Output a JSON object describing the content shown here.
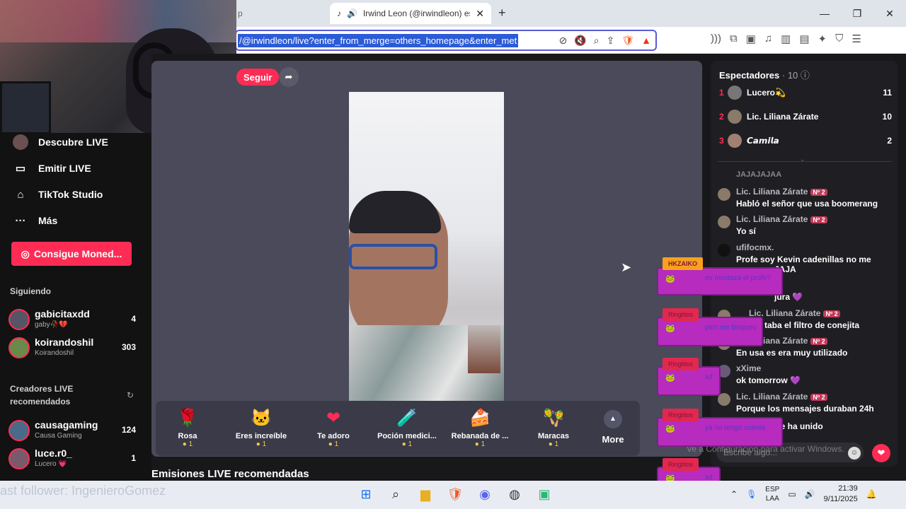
{
  "browser": {
    "prev_tab_fragment": "p",
    "tab_title": "Irwind Leon (@irwindleon) es",
    "url": "/@irwindleon/live?enter_from_merge=others_homepage&enter_met"
  },
  "sidebar": {
    "items": [
      {
        "label": "Descubre LIVE",
        "icon": "avatar"
      },
      {
        "label": "Emitir LIVE",
        "icon": "video-camera-icon"
      },
      {
        "label": "TikTok Studio",
        "icon": "studio-icon"
      },
      {
        "label": "Más",
        "icon": "more-dots-icon"
      }
    ],
    "coins_button": "Consigue Moned...",
    "following_title": "Siguiendo",
    "following": [
      {
        "name": "gabicitaxdd",
        "sub": "gaby🥀💔",
        "count": "4"
      },
      {
        "name": "koirandoshil",
        "sub": "Koirandoshil",
        "count": "303"
      }
    ],
    "recommended_title": "Creadores LIVE recomendados",
    "recommended": [
      {
        "name": "causagaming",
        "sub": "Causa Gaming",
        "count": "124"
      },
      {
        "name": "luce.r0_",
        "sub": "Lucero 💗",
        "count": "1"
      }
    ]
  },
  "stream": {
    "follow_label": "Seguir",
    "gifts": [
      {
        "icon": "🌹",
        "name": "Rosa",
        "price": "1"
      },
      {
        "icon": "🐱",
        "name": "Eres increíble",
        "price": "1"
      },
      {
        "icon": "❤",
        "name": "Te adoro",
        "price": "1"
      },
      {
        "icon": "🧪",
        "name": "Poción medici...",
        "price": "1"
      },
      {
        "icon": "🍰",
        "name": "Rebanada de ...",
        "price": "1"
      },
      {
        "icon": "🪇",
        "name": "Maracas",
        "price": "1"
      }
    ],
    "more_label": "More",
    "recommended_heading": "Emisiones LIVE recomendadas"
  },
  "panel": {
    "viewers_label": "Espectadores",
    "viewers_count": "· 10",
    "ranking": [
      {
        "rank": "1",
        "name": "Lucero💫",
        "score": "11"
      },
      {
        "rank": "2",
        "name": "Lic. Liliana Zárate",
        "score": "10"
      },
      {
        "rank": "3",
        "name": "𝘾𝙖𝙢𝙞𝙡𝙖",
        "score": "2"
      }
    ],
    "chat_top_fragment": "JAJAJAJAA",
    "messages": [
      {
        "user": "Lic. Liliana Zárate",
        "badge": "Nº 2",
        "text": "Habló el señor que usa boomerang"
      },
      {
        "user": "Lic. Liliana Zárate",
        "badge": "Nº 2",
        "text": "Yo sí"
      },
      {
        "user": "ufifocmx.",
        "badge": "",
        "text": "Profe soy Kevin cadenillas no me"
      },
      {
        "user": "",
        "badge": "",
        "text": "JAJA"
      },
      {
        "user": "",
        "badge": "",
        "text": "jura 💜"
      },
      {
        "user": "Lic. Liliana Zárate",
        "badge": "Nº 2",
        "text": "taba el filtro de conejita"
      },
      {
        "user": "Lic. Liliana Zárate",
        "badge": "Nº 2",
        "text": "En usa es era muy utilizado"
      },
      {
        "user": "xXime",
        "badge": "",
        "text": "ok tomorrow 💜"
      },
      {
        "user": "Lic. Liliana Zárate",
        "badge": "Nº 2",
        "text": "Porque los mensajes duraban 24h"
      },
      {
        "user": "",
        "badge": "",
        "text": "se ha unido"
      }
    ],
    "input_placeholder": "Escribe algo...",
    "windows_watermark": "Ve a Configuración para activar Windows."
  },
  "overlay": [
    {
      "tag": "HKZAIKO",
      "msg": "es mostaza el profe?"
    },
    {
      "tag": "Ringtitos",
      "msg": "pirrr me bloqueo"
    },
    {
      "tag": "Ringtitos",
      "msg": "xd"
    },
    {
      "tag": "Ringtitos",
      "msg": "ya no tengo cuenta"
    },
    {
      "tag": "Ringtitos",
      "msg": "xd"
    }
  ],
  "taskbar": {
    "last_follower": "ast follower: IngenieroGomez",
    "lang_top": "ESP",
    "lang_bottom": "LAA",
    "time": "21:39",
    "date": "9/11/2025"
  },
  "colors": {
    "accent": "#fe2c55",
    "overlay": "#b72bbf",
    "url_highlight": "#2b5bd6"
  }
}
